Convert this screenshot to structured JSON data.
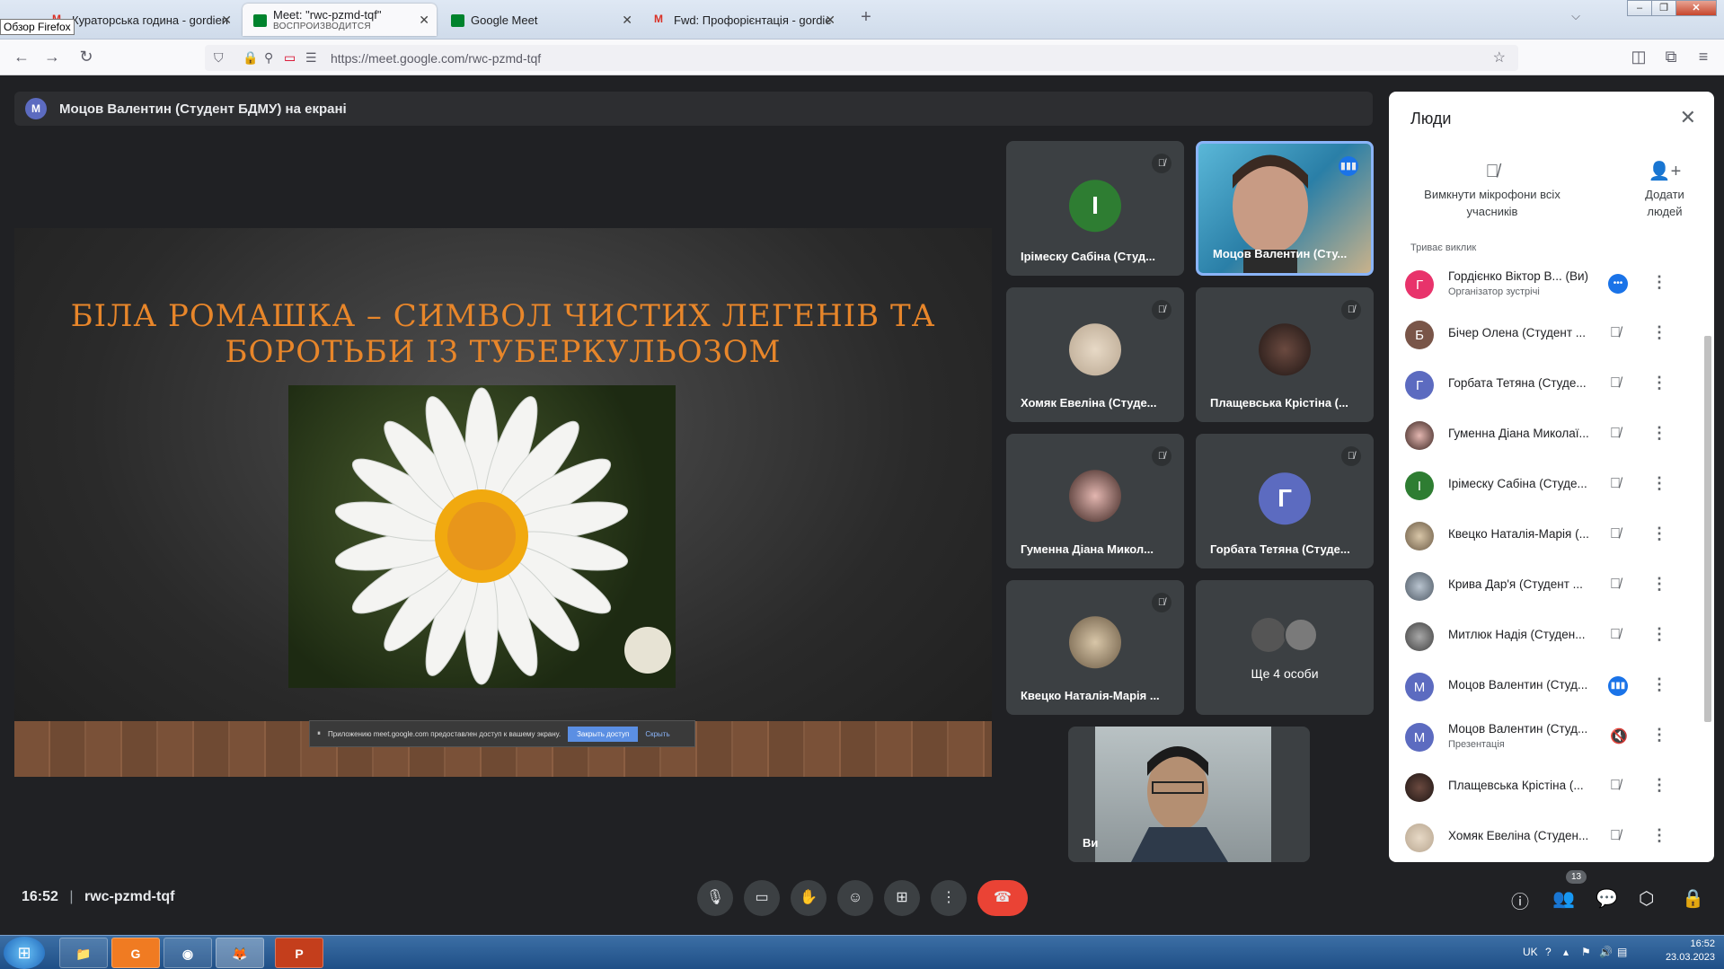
{
  "browser": {
    "tooltip": "Обзор Firefox",
    "tabs": [
      {
        "label": "Кураторська година - gordien",
        "close": "✕"
      },
      {
        "label": "Meet: \"rwc-pzmd-tqf\"",
        "sub": "ВОСПРОИЗВОДИТСЯ",
        "close": "✕"
      },
      {
        "label": "Google Meet",
        "close": "✕"
      },
      {
        "label": "Fwd: Профорієнтація - gordie",
        "close": "✕"
      }
    ],
    "url": "https://meet.google.com/rwc-pzmd-tqf"
  },
  "banner": {
    "avatar": "M",
    "text": "Моцов Валентин (Студент БДМУ) на екрані"
  },
  "slide": {
    "title_line1": "БІЛА РОМАШКА – СИМВОЛ ЧИСТИХ ЛЕГЕНІВ ТА",
    "title_line2": "БОРОТЬБИ ІЗ ТУБЕРКУЛЬОЗОМ",
    "share_text": "Приложению meet.google.com предоставлен доступ к вашему экрану.",
    "share_stop": "Закрыть доступ",
    "share_hide": "Скрыть"
  },
  "tiles": [
    {
      "name": "Ірімеску Сабіна (Студ...",
      "initial": "І"
    },
    {
      "name": "Моцов Валентин (Сту..."
    },
    {
      "name": "Хомяк Евеліна (Студе..."
    },
    {
      "name": "Плащевська Крістіна (..."
    },
    {
      "name": "Гуменна Діана Микол..."
    },
    {
      "name": "Горбата Тетяна (Студе...",
      "initial": "Г"
    },
    {
      "name": "Квецко Наталія-Марія ..."
    },
    {
      "name": "Ще 4 особи"
    },
    {
      "name": "Ви"
    }
  ],
  "people": {
    "title": "Люди",
    "mute_all": "Вимкнути мікрофони всіх учасників",
    "add": "Додати людей",
    "section": "Триває виклик",
    "list": [
      {
        "initial": "Г",
        "name": "Гордієнко Віктор В...  (Ви)",
        "sub": "Організатор зустрічі",
        "color": "#e8336b"
      },
      {
        "initial": "Б",
        "name": "Бічер Олена (Студент ...",
        "color": "#795548"
      },
      {
        "initial": "Г",
        "name": "Горбата Тетяна (Студе...",
        "color": "#5c6bc0"
      },
      {
        "initial": "",
        "name": "Гуменна Діана Миколаї...",
        "color": "#6d4c41"
      },
      {
        "initial": "І",
        "name": "Ірімеску Сабіна (Студе...",
        "color": "#2e7d32"
      },
      {
        "initial": "",
        "name": "Квецко Наталія-Марія (...",
        "color": "#8d7b5a"
      },
      {
        "initial": "",
        "name": "Крива Дар'я (Студент ...",
        "color": "#7e8b9c"
      },
      {
        "initial": "",
        "name": "Митлюк Надія (Студен...",
        "color": "#6b6b6b"
      },
      {
        "initial": "М",
        "name": "Моцов Валентин (Студ...",
        "color": "#5c6bc0"
      },
      {
        "initial": "М",
        "name": "Моцов Валентин (Студ...",
        "sub": "Презентація",
        "color": "#5c6bc0"
      },
      {
        "initial": "",
        "name": "Плащевська Крістіна (...",
        "color": "#3a2e2a"
      },
      {
        "initial": "",
        "name": "Хомяк Евеліна (Студен...",
        "color": "#9a8a78"
      }
    ]
  },
  "controls": {
    "time": "16:52",
    "code": "rwc-pzmd-tqf",
    "people_count": "13"
  },
  "taskbar": {
    "lang": "UK",
    "time": "16:52",
    "date": "23.03.2023"
  }
}
